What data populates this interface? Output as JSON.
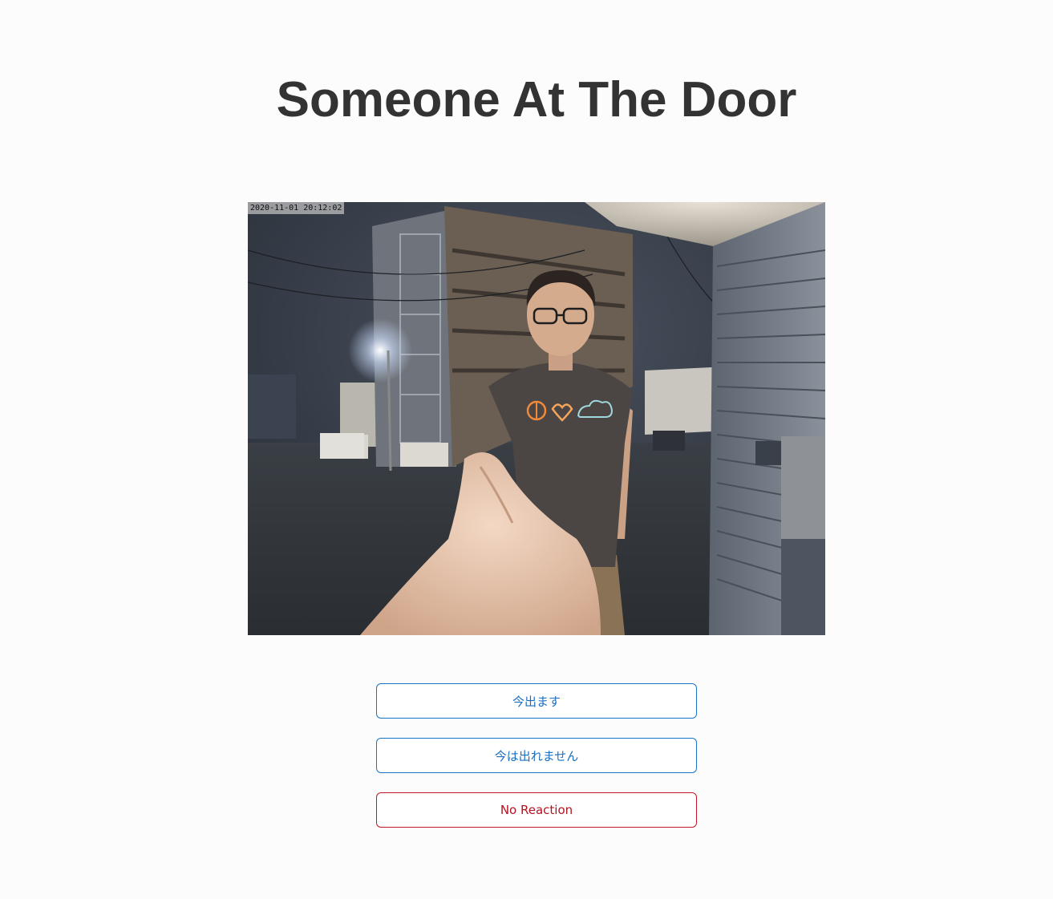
{
  "page": {
    "title": "Someone At The Door"
  },
  "camera": {
    "timestamp": "2020-11-01 20:12:02"
  },
  "actions": {
    "coming_label": "今出ます",
    "cannot_come_label": "今は出れません",
    "no_reaction_label": "No Reaction"
  },
  "colors": {
    "primary": "#1a6ec0",
    "danger": "#b5121f",
    "title": "#333333"
  }
}
